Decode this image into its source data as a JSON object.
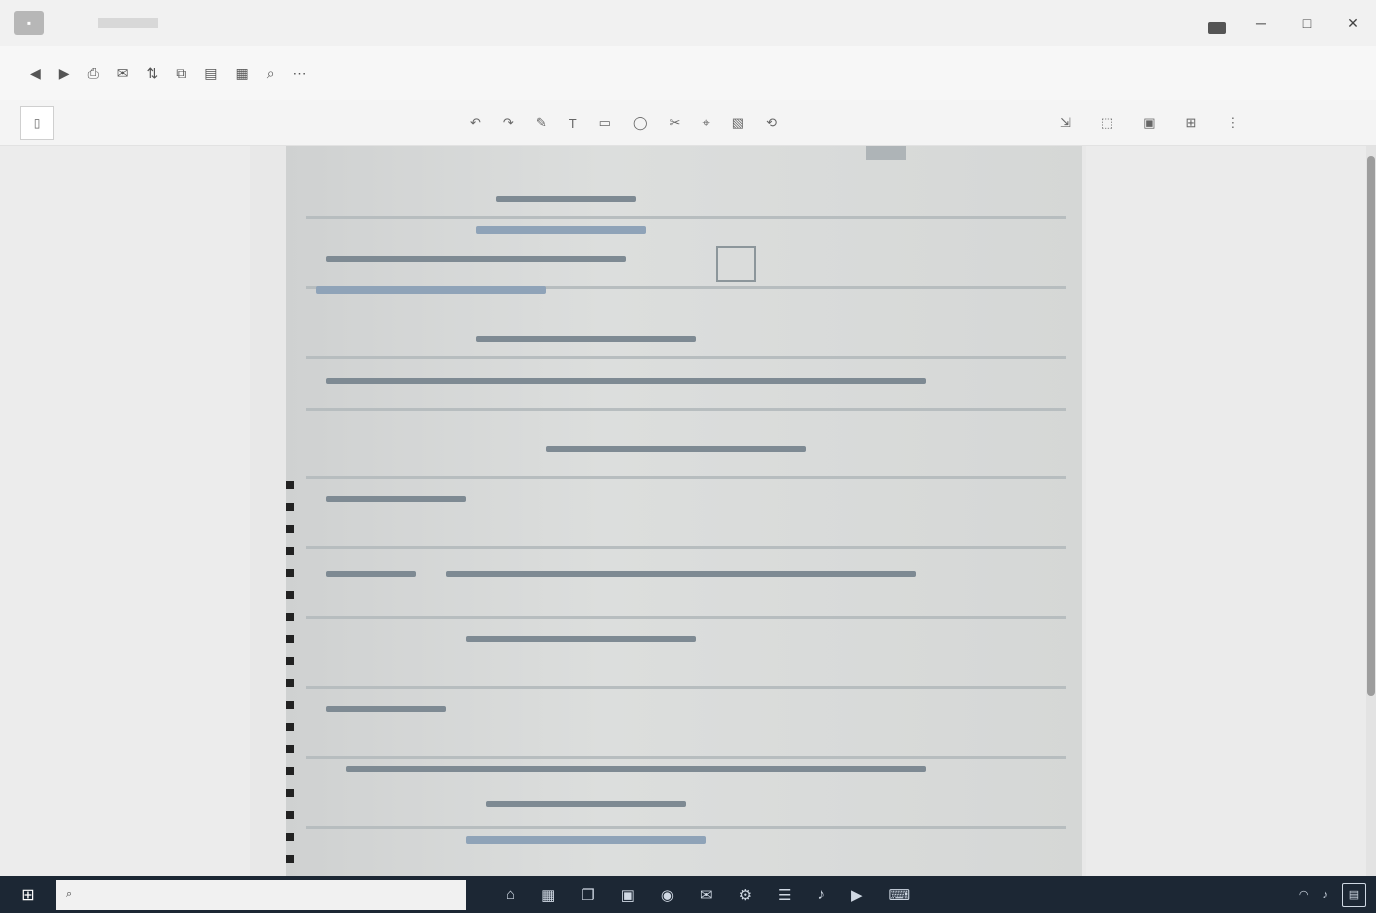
{
  "titlebar": {
    "app_icon": "pdf-viewer-app-icon",
    "title": "",
    "minimize_glyph": "─",
    "maximize_glyph": "□",
    "close_glyph": "✕"
  },
  "toolbar1": {
    "items": [
      {
        "icon": "◀",
        "label": ""
      },
      {
        "icon": "▶",
        "label": ""
      },
      {
        "icon": "⎙",
        "label": ""
      },
      {
        "icon": "✉",
        "label": ""
      },
      {
        "icon": "⇅",
        "label": ""
      },
      {
        "icon": "⧉",
        "label": ""
      },
      {
        "icon": "▤",
        "label": ""
      },
      {
        "icon": "▦",
        "label": ""
      },
      {
        "icon": "⌕",
        "label": ""
      },
      {
        "icon": "⋯",
        "label": ""
      }
    ]
  },
  "toolbar2": {
    "panel_toggle_glyph": "▯",
    "page_field": "",
    "tools_left": [
      "↶",
      "↷",
      "✎",
      "T",
      "▭",
      "◯",
      "✂",
      "⌖",
      "▧",
      "⟲"
    ],
    "tools_right": [
      "⇲",
      "⬚",
      "▣",
      "⊞",
      "⋮"
    ]
  },
  "taskbar": {
    "start_glyph": "⊞",
    "search_icon": "search-icon",
    "search_placeholder": "",
    "apps": [
      "⌂",
      "▦",
      "❐",
      "▣",
      "◉",
      "✉",
      "⚙",
      "☰",
      "♪",
      "▶",
      "⌨"
    ],
    "tray": [],
    "notification_glyph": "▤"
  }
}
